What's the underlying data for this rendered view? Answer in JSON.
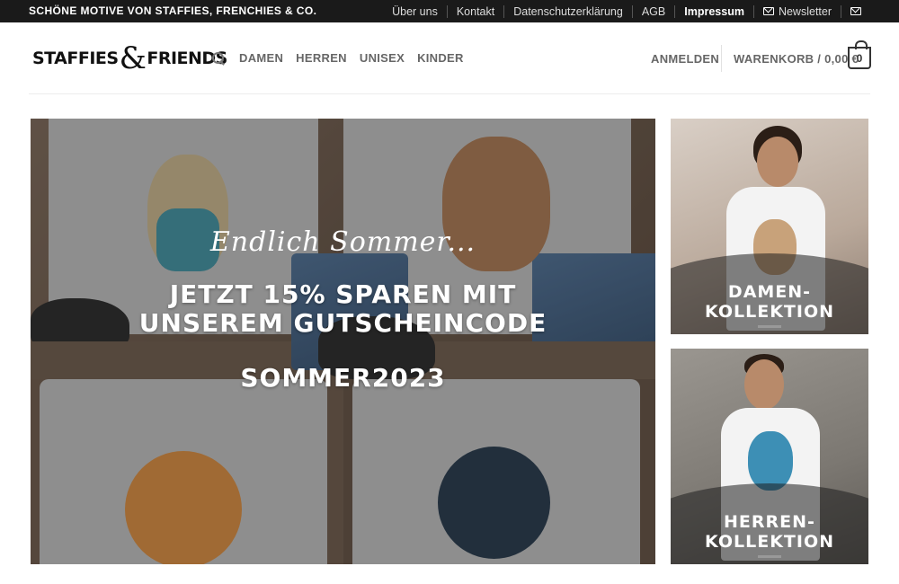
{
  "topbar": {
    "tagline": "SCHÖNE MOTIVE VON STAFFIES, FRENCHIES & CO.",
    "links": [
      "Über uns",
      "Kontakt",
      "Datenschutzerklärung",
      "AGB",
      "Impressum",
      "Newsletter"
    ],
    "icons": [
      "mail-icon",
      "mail-icon"
    ]
  },
  "header": {
    "logo_left": "STAFFIES",
    "logo_amp": "&",
    "logo_right": "FRIENDS",
    "nav": [
      "DAMEN",
      "HERREN",
      "UNISEX",
      "KINDER"
    ],
    "login": "ANMELDEN",
    "cart": "WARENKORB / 0,00 €",
    "cart_count": "0"
  },
  "hero": {
    "script": "Endlich Sommer...",
    "title_line1": "JETZT 15% SPAREN MIT",
    "title_line2": "UNSEREM GUTSCHEINCODE",
    "code": "SOMMER2023"
  },
  "tiles": {
    "women_line1": "DAMEN-",
    "women_line2": "KOLLEKTION",
    "men_line1": "HERREN-",
    "men_line2": "KOLLEKTION"
  },
  "colors": {
    "topbar": "#1a1a1a",
    "text": "#666666"
  }
}
